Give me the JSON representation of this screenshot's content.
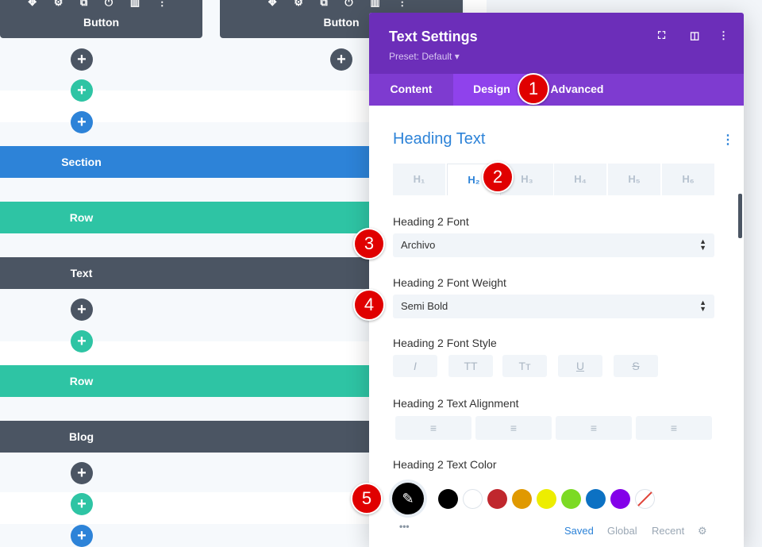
{
  "builder": {
    "columns": [
      {
        "header": "Button"
      },
      {
        "header": "Button"
      }
    ],
    "card_icons": "✥ ⚙ ⧉ ⏻ ▥ ⋮",
    "bars": [
      {
        "label": "Section",
        "color": "#2d83d8"
      },
      {
        "label": "Row",
        "color": "#2ec4a4"
      },
      {
        "label": "Text",
        "color": "#4b5563"
      },
      {
        "label": "Row",
        "color": "#2ec4a4"
      },
      {
        "label": "Blog",
        "color": "#4b5563"
      }
    ],
    "plus": "+"
  },
  "modal": {
    "title": "Text Settings",
    "preset": "Preset: Default ▾",
    "header_icons": {
      "expand": "⛶",
      "split": "◫",
      "more": "⋮"
    },
    "tabs": [
      {
        "label": "Content",
        "active": false
      },
      {
        "label": "Design",
        "active": true
      },
      {
        "label": "Advanced",
        "active": false
      }
    ],
    "section_title": "Heading Text",
    "section_menu": "⋮",
    "heading_tabs": [
      {
        "label": "H₁",
        "active": false
      },
      {
        "label": "H₂",
        "active": true
      },
      {
        "label": "H₃",
        "active": false
      },
      {
        "label": "H₄",
        "active": false
      },
      {
        "label": "H₅",
        "active": false
      },
      {
        "label": "H₆",
        "active": false
      }
    ],
    "font": {
      "label": "Heading 2 Font",
      "value": "Archivo"
    },
    "weight": {
      "label": "Heading 2 Font Weight",
      "value": "Semi Bold"
    },
    "style": {
      "label": "Heading 2 Font Style",
      "buttons": [
        "I",
        "TT",
        "Tᴛ",
        "U",
        "S"
      ]
    },
    "alignment": {
      "label": "Heading 2 Text Alignment",
      "buttons": [
        "≡",
        "≡",
        "≡",
        "≡"
      ]
    },
    "color": {
      "label": "Heading 2 Text Color",
      "picker_icon": "✎",
      "swatches": [
        "#000000",
        "#ffffff",
        "#c0272d",
        "#e09900",
        "#eded00",
        "#7cda24",
        "#0c71c3",
        "#8300e9"
      ],
      "more": "•••",
      "footer": {
        "saved": "Saved",
        "global": "Global",
        "recent": "Recent",
        "gear": "⚙"
      }
    }
  },
  "badges": [
    "1",
    "2",
    "3",
    "4",
    "5"
  ]
}
